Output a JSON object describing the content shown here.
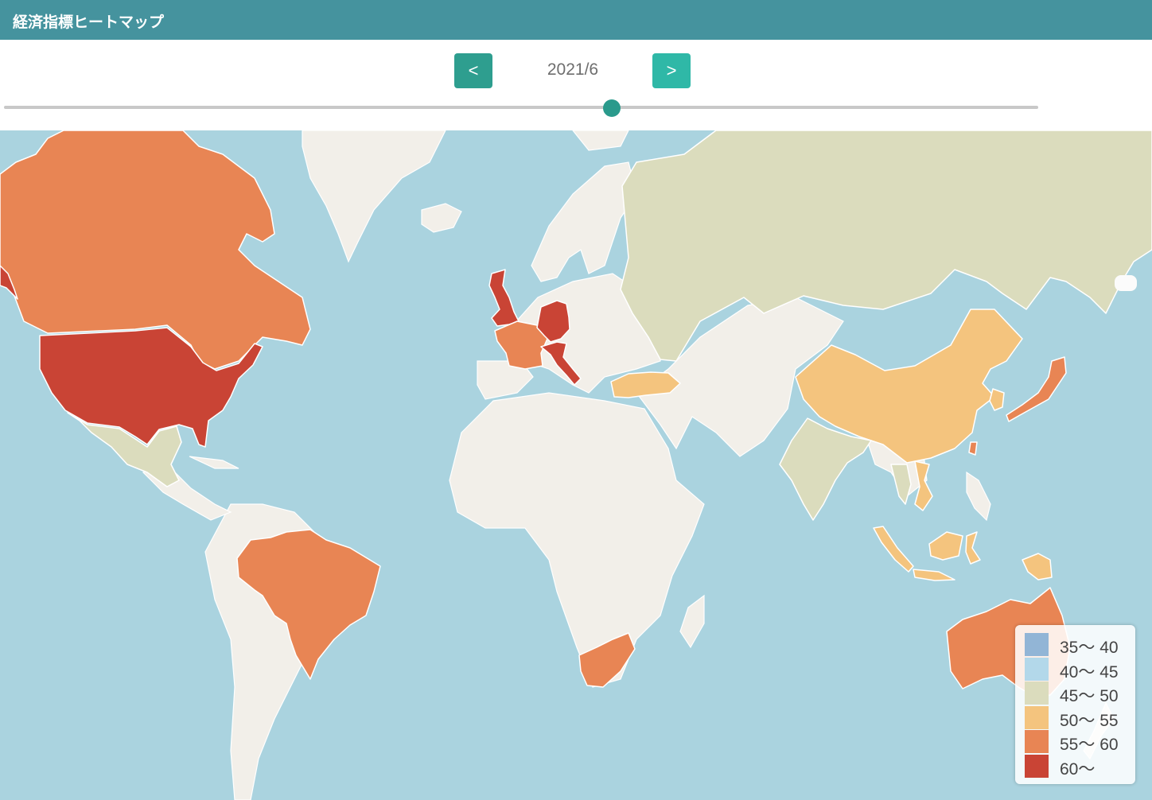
{
  "header": {
    "title": "経済指標ヒートマップ"
  },
  "controls": {
    "prev_label": "<",
    "next_label": ">",
    "current_date": "2021/6"
  },
  "slider": {
    "position_fraction": 0.588
  },
  "legend": {
    "items": [
      {
        "label": "35〜 40",
        "color": "#92b5d6"
      },
      {
        "label": "40〜 45",
        "color": "#b3d8ea"
      },
      {
        "label": "45〜 50",
        "color": "#dbdcbd"
      },
      {
        "label": "50〜 55",
        "color": "#f4c47e"
      },
      {
        "label": "55〜 60",
        "color": "#e88554"
      },
      {
        "label": "60〜",
        "color": "#c94435"
      }
    ]
  },
  "colors": {
    "water": "#aad3df",
    "land": "#f2efe9"
  },
  "countries": [
    {
      "name": "canada",
      "bin": 4
    },
    {
      "name": "usa",
      "bin": 5
    },
    {
      "name": "mexico",
      "bin": 2
    },
    {
      "name": "brazil",
      "bin": 4
    },
    {
      "name": "uk",
      "bin": 5
    },
    {
      "name": "france",
      "bin": 4
    },
    {
      "name": "germany",
      "bin": 5
    },
    {
      "name": "italy",
      "bin": 5
    },
    {
      "name": "turkey",
      "bin": 3
    },
    {
      "name": "russia",
      "bin": 2
    },
    {
      "name": "china",
      "bin": 3
    },
    {
      "name": "india",
      "bin": 2
    },
    {
      "name": "japan",
      "bin": 4
    },
    {
      "name": "south-korea",
      "bin": 3
    },
    {
      "name": "taiwan",
      "bin": 4
    },
    {
      "name": "vietnam",
      "bin": 3
    },
    {
      "name": "thailand",
      "bin": 2
    },
    {
      "name": "indonesia",
      "bin": 3
    },
    {
      "name": "papua-new-guinea",
      "bin": 3
    },
    {
      "name": "australia",
      "bin": 4
    },
    {
      "name": "south-africa",
      "bin": 4
    }
  ]
}
